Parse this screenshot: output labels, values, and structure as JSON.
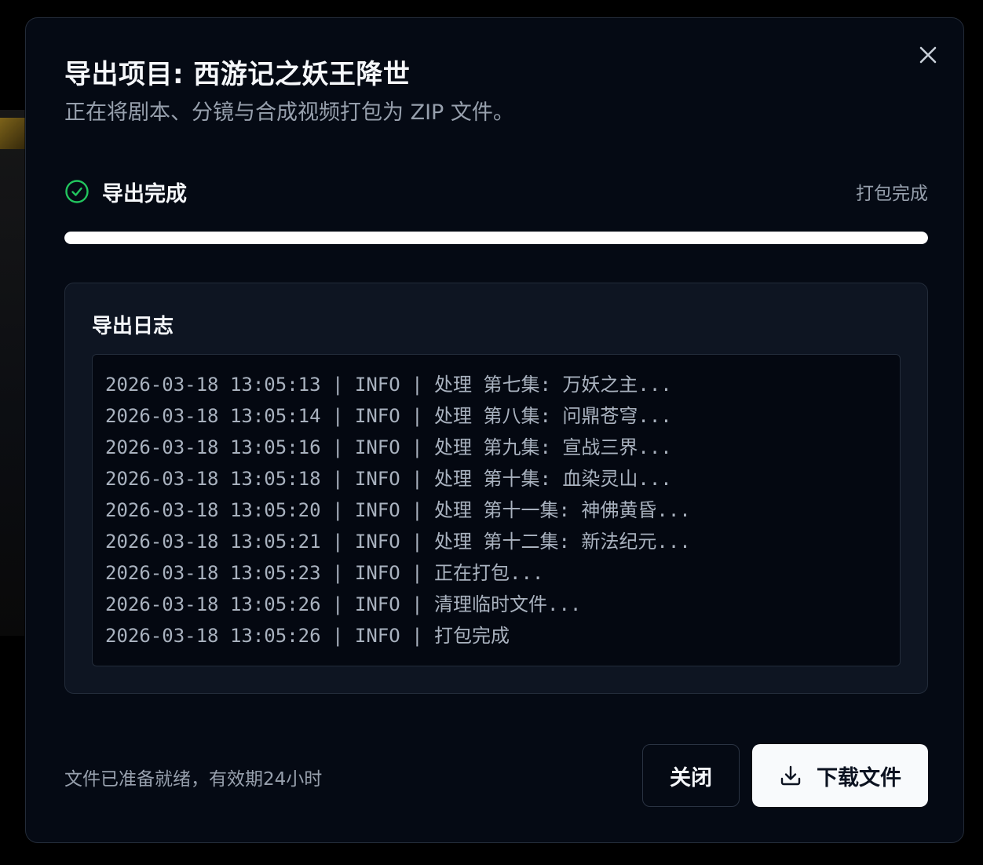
{
  "dialog": {
    "title": "导出项目: 西游记之妖王降世",
    "subtitle": "正在将剧本、分镜与合成视频打包为 ZIP 文件。",
    "close_icon": "close-icon"
  },
  "status": {
    "icon": "check-circle-icon",
    "label": "导出完成",
    "detail": "打包完成",
    "progress": 1.0,
    "accent_color": "#22c55e"
  },
  "log": {
    "title": "导出日志",
    "lines": [
      "2026-03-18 13:05:13 | INFO | 处理 第七集: 万妖之主...",
      "2026-03-18 13:05:14 | INFO | 处理 第八集: 问鼎苍穹...",
      "2026-03-18 13:05:16 | INFO | 处理 第九集: 宣战三界...",
      "2026-03-18 13:05:18 | INFO | 处理 第十集: 血染灵山...",
      "2026-03-18 13:05:20 | INFO | 处理 第十一集: 神佛黄昏...",
      "2026-03-18 13:05:21 | INFO | 处理 第十二集: 新法纪元...",
      "2026-03-18 13:05:23 | INFO | 正在打包...",
      "2026-03-18 13:05:26 | INFO | 清理临时文件...",
      "2026-03-18 13:05:26 | INFO | 打包完成"
    ]
  },
  "footer": {
    "note": "文件已准备就绪，有效期24小时",
    "close_label": "关闭",
    "download_label": "下载文件",
    "download_icon": "download-icon"
  }
}
